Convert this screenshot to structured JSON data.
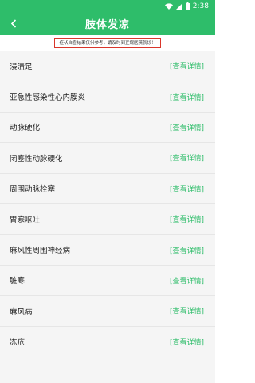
{
  "status_bar": {
    "time": "2:38"
  },
  "header": {
    "title": "肢体发凉"
  },
  "notice": {
    "text": "症状自查结果仅供参考，请及时到正规医院就诊！"
  },
  "list": {
    "link_label": "[查看详情]",
    "items": [
      {
        "label": "浸渍足"
      },
      {
        "label": "亚急性感染性心内膜炎"
      },
      {
        "label": "动脉硬化"
      },
      {
        "label": "闭塞性动脉硬化"
      },
      {
        "label": "周围动脉栓塞"
      },
      {
        "label": "胃寒呕吐"
      },
      {
        "label": "麻风性周围神经病"
      },
      {
        "label": "脏寒"
      },
      {
        "label": "麻风病"
      },
      {
        "label": "冻疮"
      }
    ]
  },
  "colors": {
    "accent": "#2ebd6a",
    "notice_border": "#d9362b"
  }
}
